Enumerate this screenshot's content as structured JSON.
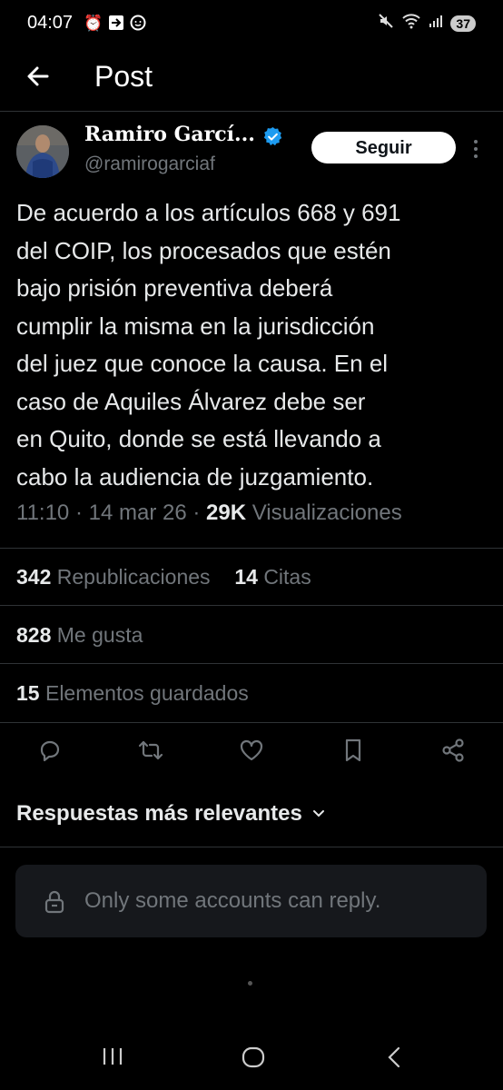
{
  "status_bar": {
    "time": "04:07",
    "battery": "37",
    "icons": [
      "alarm-icon",
      "cast-icon",
      "messenger-icon",
      "mute-icon",
      "wifi-icon",
      "signal-icon"
    ]
  },
  "header": {
    "title": "Post"
  },
  "author": {
    "name": "Ramiro Garcí...",
    "handle": "@ramirogarciaf",
    "verified": true
  },
  "follow_label": "Seguir",
  "tweet": {
    "text": "De acuerdo a los artículos 668 y 691\ndel COIP, los procesados que estén\nbajo prisión preventiva deberá\ncumplir la misma en la jurisdicción\ndel juez que conoce la causa. En el\ncaso de Aquiles Álvarez debe ser\nen Quito, donde se está llevando a\ncabo la audiencia de juzgamiento.",
    "time": "11:10",
    "date": "14 mar 26",
    "views": "29K",
    "views_label": "Visualizaciones"
  },
  "stats": {
    "reposts": "342",
    "reposts_label": "Republicaciones",
    "quotes": "14",
    "quotes_label": "Citas",
    "likes": "828",
    "likes_label": "Me gusta",
    "bookmarks": "15",
    "bookmarks_label": "Elementos guardados"
  },
  "replies": {
    "sort_label": "Respuestas más relevantes",
    "restriction": "Only some accounts can reply."
  },
  "colors": {
    "background": "#000000",
    "text": "#e7e9ea",
    "muted": "#71767b",
    "verified": "#1d9bf0",
    "divider": "#2f3336"
  }
}
